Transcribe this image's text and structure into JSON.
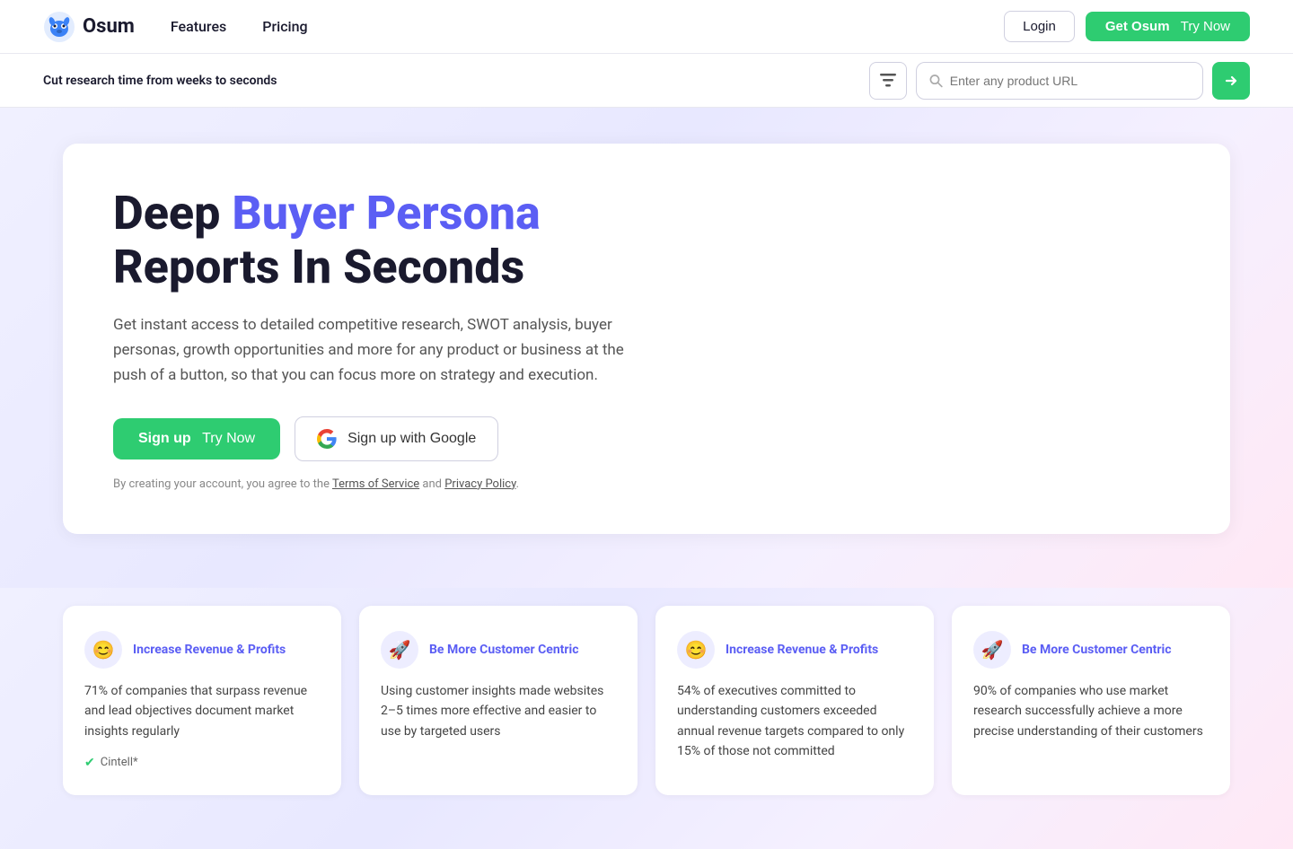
{
  "nav": {
    "logo_text": "Osum",
    "links": [
      {
        "label": "Features",
        "id": "features"
      },
      {
        "label": "Pricing",
        "id": "pricing"
      }
    ],
    "login_label": "Login",
    "get_osum_label": "Get Osum",
    "get_osum_try": "Try Now"
  },
  "searchbar": {
    "tagline": "Cut research time from weeks to seconds",
    "placeholder": "Enter any product URL",
    "go_arrow": "›"
  },
  "hero": {
    "title_plain": "Deep ",
    "title_highlight": "Buyer Persona",
    "title_rest": " Reports In Seconds",
    "subtitle": "Get instant access to detailed competitive research, SWOT analysis, buyer personas, growth opportunities and more for any product or business at the push of a button, so that you can focus more on strategy and execution.",
    "signup_btn_bold": "Sign up",
    "signup_btn_light": "Try Now",
    "google_btn": "Sign up with Google",
    "legal_prefix": "By creating your account, you agree to the ",
    "legal_tos": "Terms of Service",
    "legal_and": " and ",
    "legal_privacy": "Privacy Policy",
    "legal_suffix": "."
  },
  "features": [
    {
      "icon": "😊",
      "icon_type": "smiley",
      "title": "Increase Revenue & Profits",
      "body": "71% of companies that surpass revenue and lead objectives document market insights regularly",
      "source": "Cintell*",
      "has_check": true
    },
    {
      "icon": "🚀",
      "icon_type": "rocket",
      "title": "Be More Customer Centric",
      "body": "Using customer insights made websites 2–5 times more effective and easier to use by targeted users",
      "source": "",
      "has_check": false
    },
    {
      "icon": "😊",
      "icon_type": "smiley",
      "title": "Increase Revenue & Profits",
      "body": "54% of executives committed to understanding customers exceeded annual revenue targets compared to only 15% of those not committed",
      "source": "",
      "has_check": false
    },
    {
      "icon": "🚀",
      "icon_type": "rocket",
      "title": "Be More Customer Centric",
      "body": "90% of companies who use market research successfully achieve a more precise understanding of their customers",
      "source": "",
      "has_check": false
    }
  ]
}
